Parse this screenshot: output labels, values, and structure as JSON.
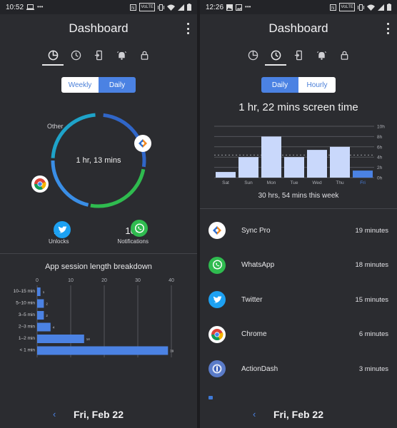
{
  "left": {
    "status": {
      "time": "10:52",
      "left_icons": [
        "laptop-icon",
        "more-dots-icon"
      ],
      "right_icons": [
        "nfc-icon",
        "volte-icon",
        "vibrate-icon",
        "wifi-icon",
        "signal-icon",
        "battery-icon"
      ],
      "volte": "VoLTE"
    },
    "header": {
      "title": "Dashboard"
    },
    "tabs": [
      "pie-chart-icon",
      "clock-icon",
      "phone-unlock-icon",
      "bell-icon",
      "lock-icon"
    ],
    "active_tab": 0,
    "toggle": {
      "left": "Weekly",
      "right": "Daily",
      "selected": "Daily"
    },
    "donut": {
      "center_label": "1 hr, 13 mins",
      "other_label": "Other",
      "colors": {
        "syncpro": "#3066c8",
        "whatsapp": "#2fbb4f",
        "twitter": "#3a8ee6",
        "other": "#1ea3c9"
      }
    },
    "stats": [
      {
        "value": "17",
        "label": "Unlocks"
      },
      {
        "value": "105",
        "label": "Notifications"
      }
    ],
    "breakdown_title": "App session length breakdown",
    "chart_data": {
      "type": "bar",
      "orientation": "horizontal",
      "categories": [
        "10–15 min",
        "5–10 min",
        "3–5 min",
        "2–3 min",
        "1–2 min",
        "< 1 min"
      ],
      "values": [
        1,
        2,
        2,
        4,
        14,
        39
      ],
      "value_labels": [
        "1",
        "2",
        "2",
        "4",
        "14",
        "39"
      ],
      "xticks": [
        0,
        10,
        20,
        30,
        40
      ],
      "xlim": [
        0,
        40
      ],
      "color": "#4b82e3"
    },
    "footer": {
      "date": "Fri, Feb 22",
      "prev": "‹"
    }
  },
  "right": {
    "status": {
      "time": "12:26",
      "left_icons": [
        "image-icon",
        "gallery-icon",
        "more-dots-icon"
      ],
      "right_icons": [
        "nfc-icon",
        "volte-icon",
        "vibrate-icon",
        "wifi-icon",
        "signal-icon",
        "battery-icon"
      ],
      "volte": "VoLTE"
    },
    "header": {
      "title": "Dashboard"
    },
    "tabs": [
      "pie-chart-icon",
      "clock-icon",
      "phone-unlock-icon",
      "bell-icon",
      "lock-icon"
    ],
    "active_tab": 1,
    "toggle": {
      "left": "Daily",
      "right": "Hourly",
      "selected": "Daily"
    },
    "screen_time": "1 hr, 22 mins screen time",
    "chart_data": {
      "type": "bar",
      "categories": [
        "Sat",
        "Sun",
        "Mon",
        "Tue",
        "Wed",
        "Thu",
        "Fri"
      ],
      "values": [
        1.1,
        4.0,
        8.0,
        4.0,
        5.4,
        6.0,
        1.37
      ],
      "highlight_index": 6,
      "yticks": [
        "0h",
        "2h",
        "4h",
        "6h",
        "8h",
        "10h"
      ],
      "ylim": [
        0,
        10
      ],
      "average": 4.4,
      "colors": {
        "bar": "#c9d8fb",
        "highlight": "#4b82e3"
      }
    },
    "week_total": "30 hrs, 54 mins this week",
    "apps": [
      {
        "name": "Sync Pro",
        "time": "19 minutes",
        "icon": "sync-pro-icon"
      },
      {
        "name": "WhatsApp",
        "time": "18 minutes",
        "icon": "whatsapp-icon"
      },
      {
        "name": "Twitter",
        "time": "15 minutes",
        "icon": "twitter-icon"
      },
      {
        "name": "Chrome",
        "time": "6 minutes",
        "icon": "chrome-icon"
      },
      {
        "name": "ActionDash",
        "time": "3 minutes",
        "icon": "actiondash-icon"
      }
    ],
    "footer": {
      "date": "Fri, Feb 22",
      "prev": "‹"
    }
  }
}
